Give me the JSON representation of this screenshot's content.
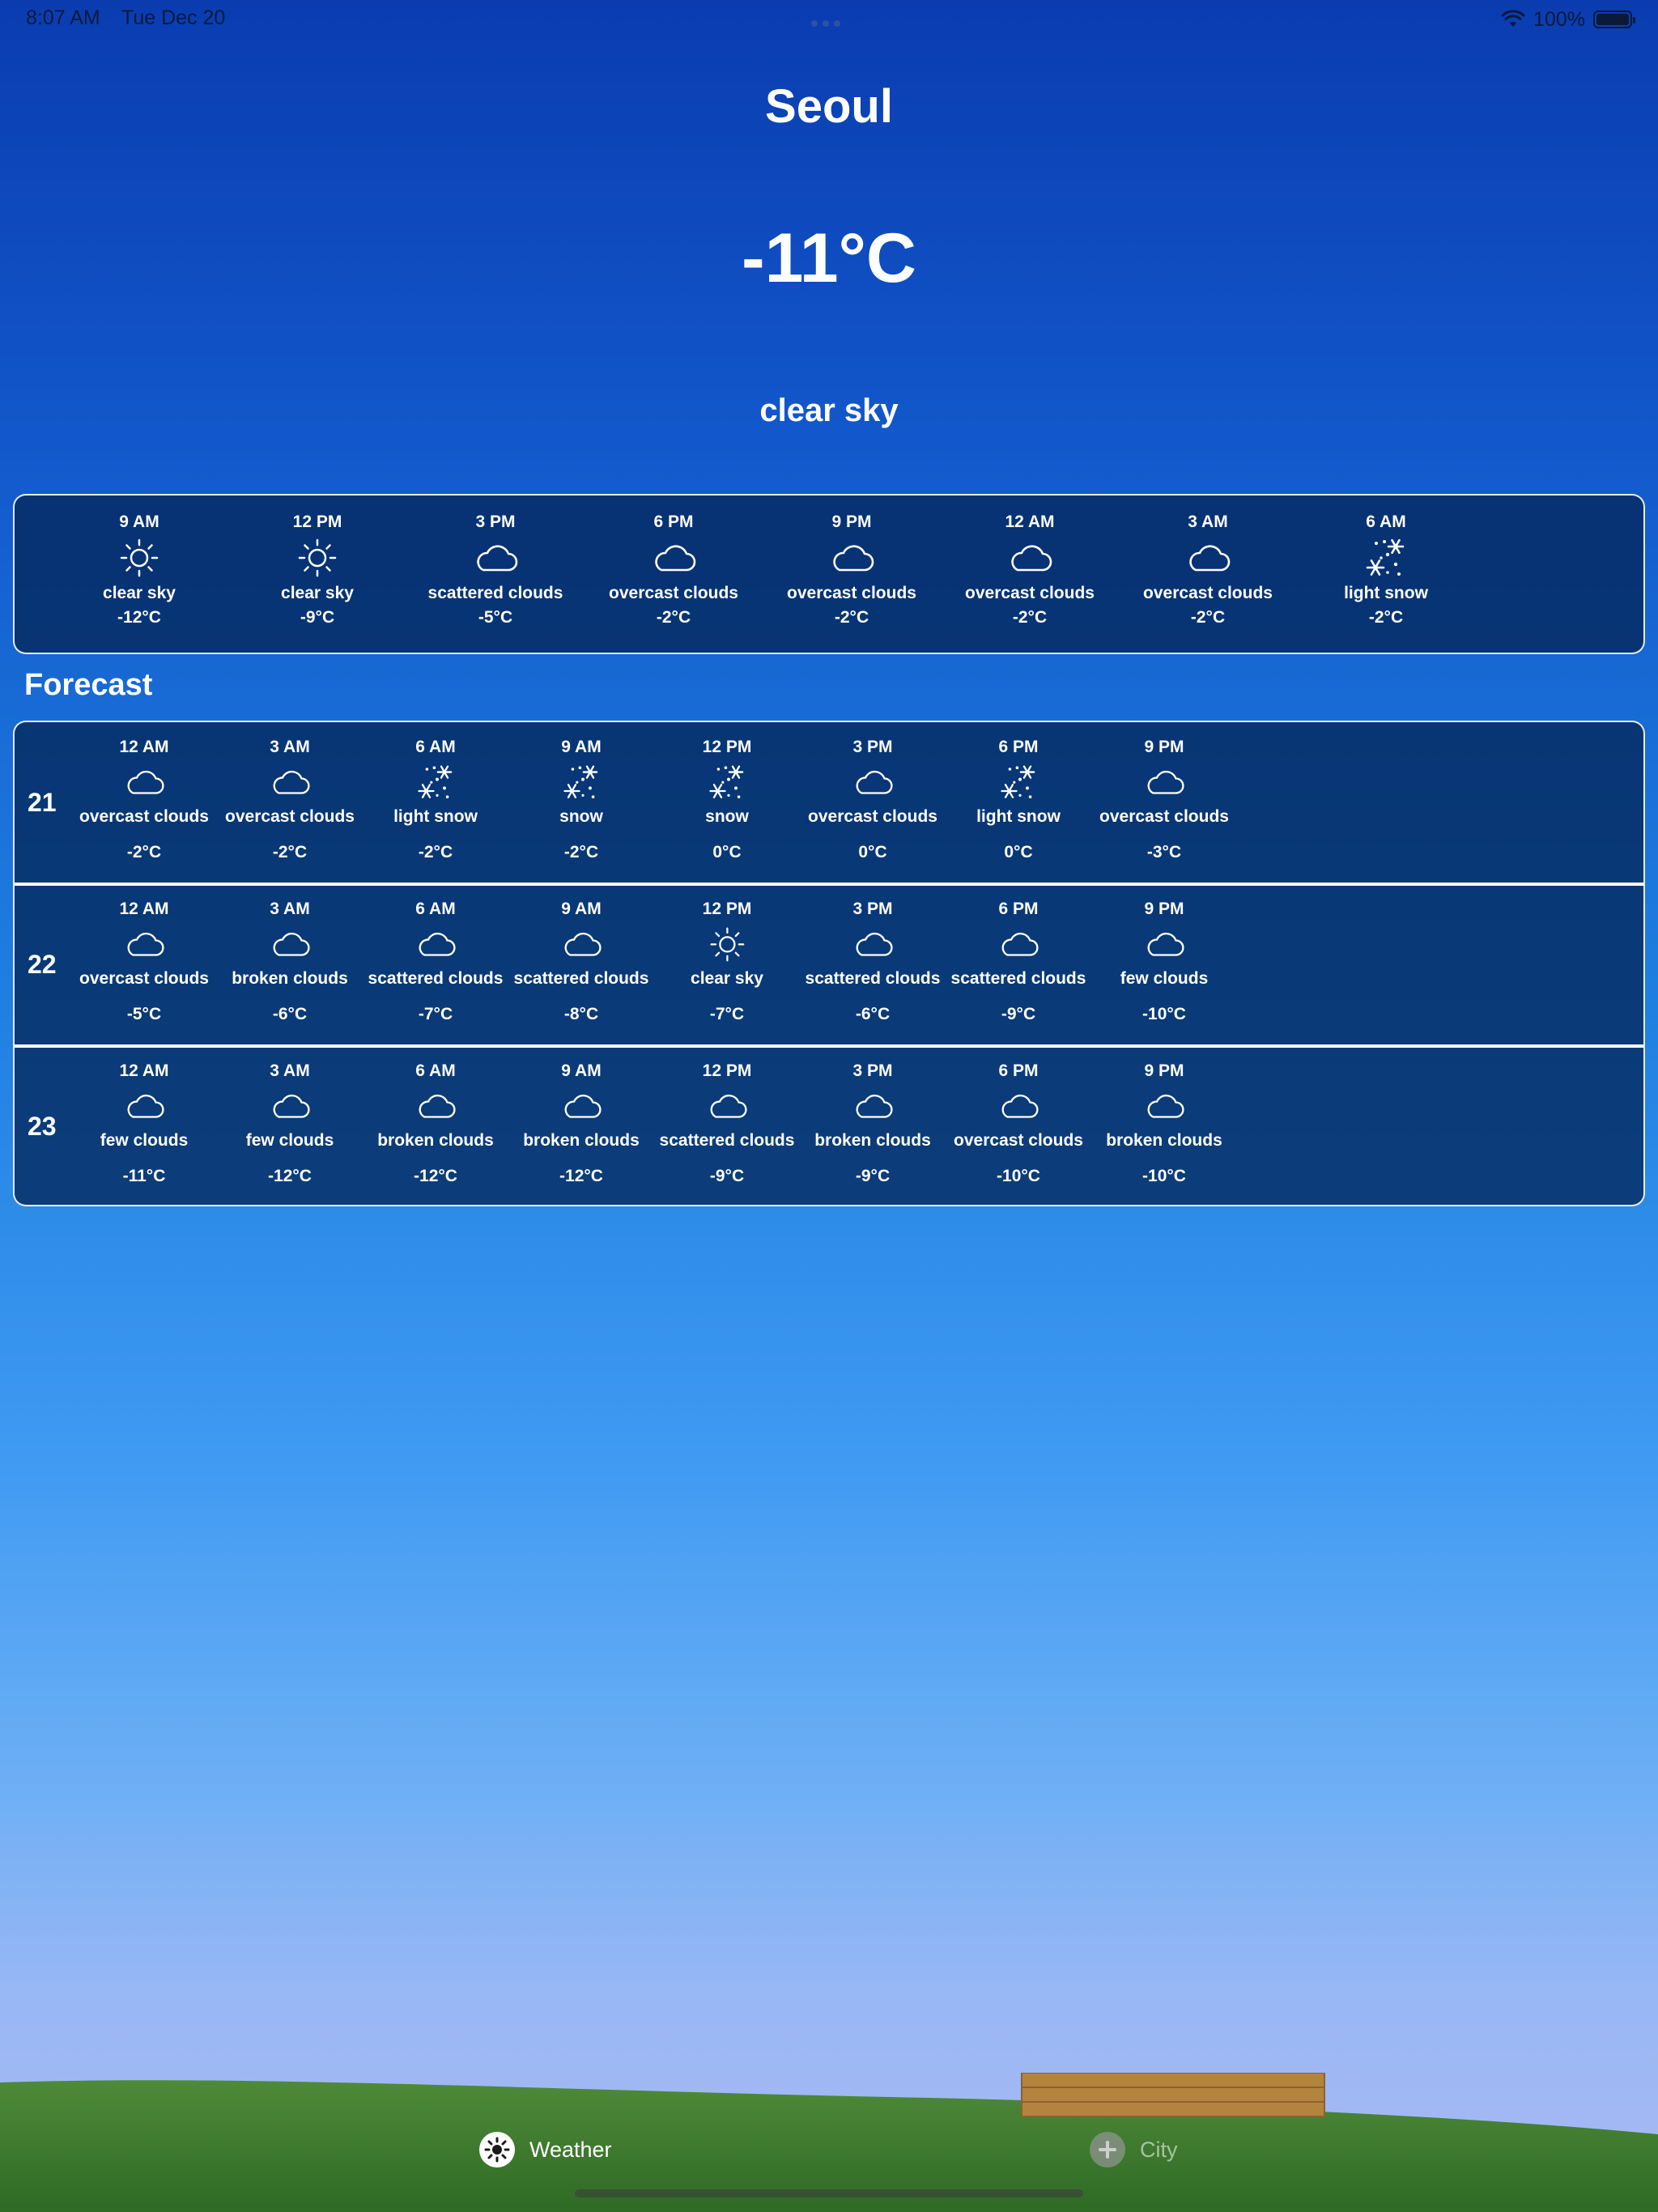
{
  "status_bar": {
    "time": "8:07 AM",
    "date": "Tue Dec 20",
    "battery": "100%",
    "icons": [
      "wifi-icon",
      "battery-icon"
    ]
  },
  "current": {
    "city": "Seoul",
    "temp": "-11°C",
    "description": "clear sky"
  },
  "hourly": [
    {
      "time": "9 AM",
      "desc": "clear sky",
      "temp": "-12°C",
      "icon": "sun-icon"
    },
    {
      "time": "12 PM",
      "desc": "clear sky",
      "temp": "-9°C",
      "icon": "sun-icon"
    },
    {
      "time": "3 PM",
      "desc": "scattered clouds",
      "temp": "-5°C",
      "icon": "cloud-icon"
    },
    {
      "time": "6 PM",
      "desc": "overcast clouds",
      "temp": "-2°C",
      "icon": "cloud-icon"
    },
    {
      "time": "9 PM",
      "desc": "overcast clouds",
      "temp": "-2°C",
      "icon": "cloud-icon"
    },
    {
      "time": "12 AM",
      "desc": "overcast clouds",
      "temp": "-2°C",
      "icon": "cloud-icon"
    },
    {
      "time": "3 AM",
      "desc": "overcast clouds",
      "temp": "-2°C",
      "icon": "cloud-icon"
    },
    {
      "time": "6 AM",
      "desc": "light snow",
      "temp": "-2°C",
      "icon": "snow-icon"
    }
  ],
  "forecast_title": "Forecast",
  "forecast": [
    {
      "day": "21",
      "slots": [
        {
          "time": "12 AM",
          "desc": "overcast clouds",
          "temp": "-2°C",
          "icon": "cloud-icon"
        },
        {
          "time": "3 AM",
          "desc": "overcast clouds",
          "temp": "-2°C",
          "icon": "cloud-icon"
        },
        {
          "time": "6 AM",
          "desc": "light snow",
          "temp": "-2°C",
          "icon": "snow-icon"
        },
        {
          "time": "9 AM",
          "desc": "snow",
          "temp": "-2°C",
          "icon": "snow-icon"
        },
        {
          "time": "12 PM",
          "desc": "snow",
          "temp": "0°C",
          "icon": "snow-icon"
        },
        {
          "time": "3 PM",
          "desc": "overcast clouds",
          "temp": "0°C",
          "icon": "cloud-icon"
        },
        {
          "time": "6 PM",
          "desc": "light snow",
          "temp": "0°C",
          "icon": "snow-icon"
        },
        {
          "time": "9 PM",
          "desc": "overcast clouds",
          "temp": "-3°C",
          "icon": "cloud-icon"
        }
      ]
    },
    {
      "day": "22",
      "slots": [
        {
          "time": "12 AM",
          "desc": "overcast clouds",
          "temp": "-5°C",
          "icon": "cloud-icon"
        },
        {
          "time": "3 AM",
          "desc": "broken clouds",
          "temp": "-6°C",
          "icon": "cloud-icon"
        },
        {
          "time": "6 AM",
          "desc": "scattered clouds",
          "temp": "-7°C",
          "icon": "cloud-icon"
        },
        {
          "time": "9 AM",
          "desc": "scattered clouds",
          "temp": "-8°C",
          "icon": "cloud-icon"
        },
        {
          "time": "12 PM",
          "desc": "clear sky",
          "temp": "-7°C",
          "icon": "sun-icon"
        },
        {
          "time": "3 PM",
          "desc": "scattered clouds",
          "temp": "-6°C",
          "icon": "cloud-icon"
        },
        {
          "time": "6 PM",
          "desc": "scattered clouds",
          "temp": "-9°C",
          "icon": "cloud-icon"
        },
        {
          "time": "9 PM",
          "desc": "few clouds",
          "temp": "-10°C",
          "icon": "cloud-icon"
        }
      ]
    },
    {
      "day": "23",
      "slots": [
        {
          "time": "12 AM",
          "desc": "few clouds",
          "temp": "-11°C",
          "icon": "cloud-icon"
        },
        {
          "time": "3 AM",
          "desc": "few clouds",
          "temp": "-12°C",
          "icon": "cloud-icon"
        },
        {
          "time": "6 AM",
          "desc": "broken clouds",
          "temp": "-12°C",
          "icon": "cloud-icon"
        },
        {
          "time": "9 AM",
          "desc": "broken clouds",
          "temp": "-12°C",
          "icon": "cloud-icon"
        },
        {
          "time": "12 PM",
          "desc": "scattered clouds",
          "temp": "-9°C",
          "icon": "cloud-icon"
        },
        {
          "time": "3 PM",
          "desc": "broken clouds",
          "temp": "-9°C",
          "icon": "cloud-icon"
        },
        {
          "time": "6 PM",
          "desc": "overcast clouds",
          "temp": "-10°C",
          "icon": "cloud-icon"
        },
        {
          "time": "9 PM",
          "desc": "broken clouds",
          "temp": "-10°C",
          "icon": "cloud-icon"
        }
      ]
    }
  ],
  "tabs": [
    {
      "label": "Weather",
      "icon": "sun-icon",
      "selected": true
    },
    {
      "label": "City",
      "icon": "plus-icon",
      "selected": false
    }
  ]
}
